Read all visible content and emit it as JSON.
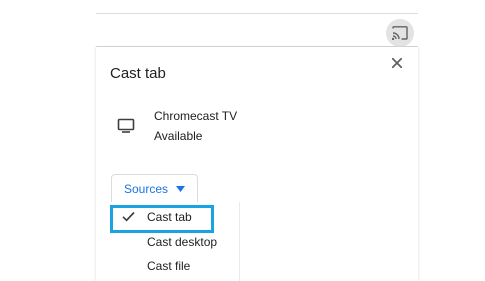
{
  "toolbar": {
    "cast_button_icon": "cast-icon"
  },
  "dialog": {
    "title": "Cast tab",
    "close_icon": "close-icon",
    "device": {
      "icon": "tv-icon",
      "name": "Chromecast TV",
      "status": "Available"
    },
    "sources": {
      "label": "Sources",
      "icon": "caret-down-icon",
      "accent_color": "#1a73e8"
    },
    "menu": {
      "items": [
        {
          "label": "Cast tab",
          "selected": true
        },
        {
          "label": "Cast desktop",
          "selected": false
        },
        {
          "label": "Cast file",
          "selected": false
        }
      ]
    }
  },
  "highlight": {
    "color": "#1aa3e0"
  }
}
